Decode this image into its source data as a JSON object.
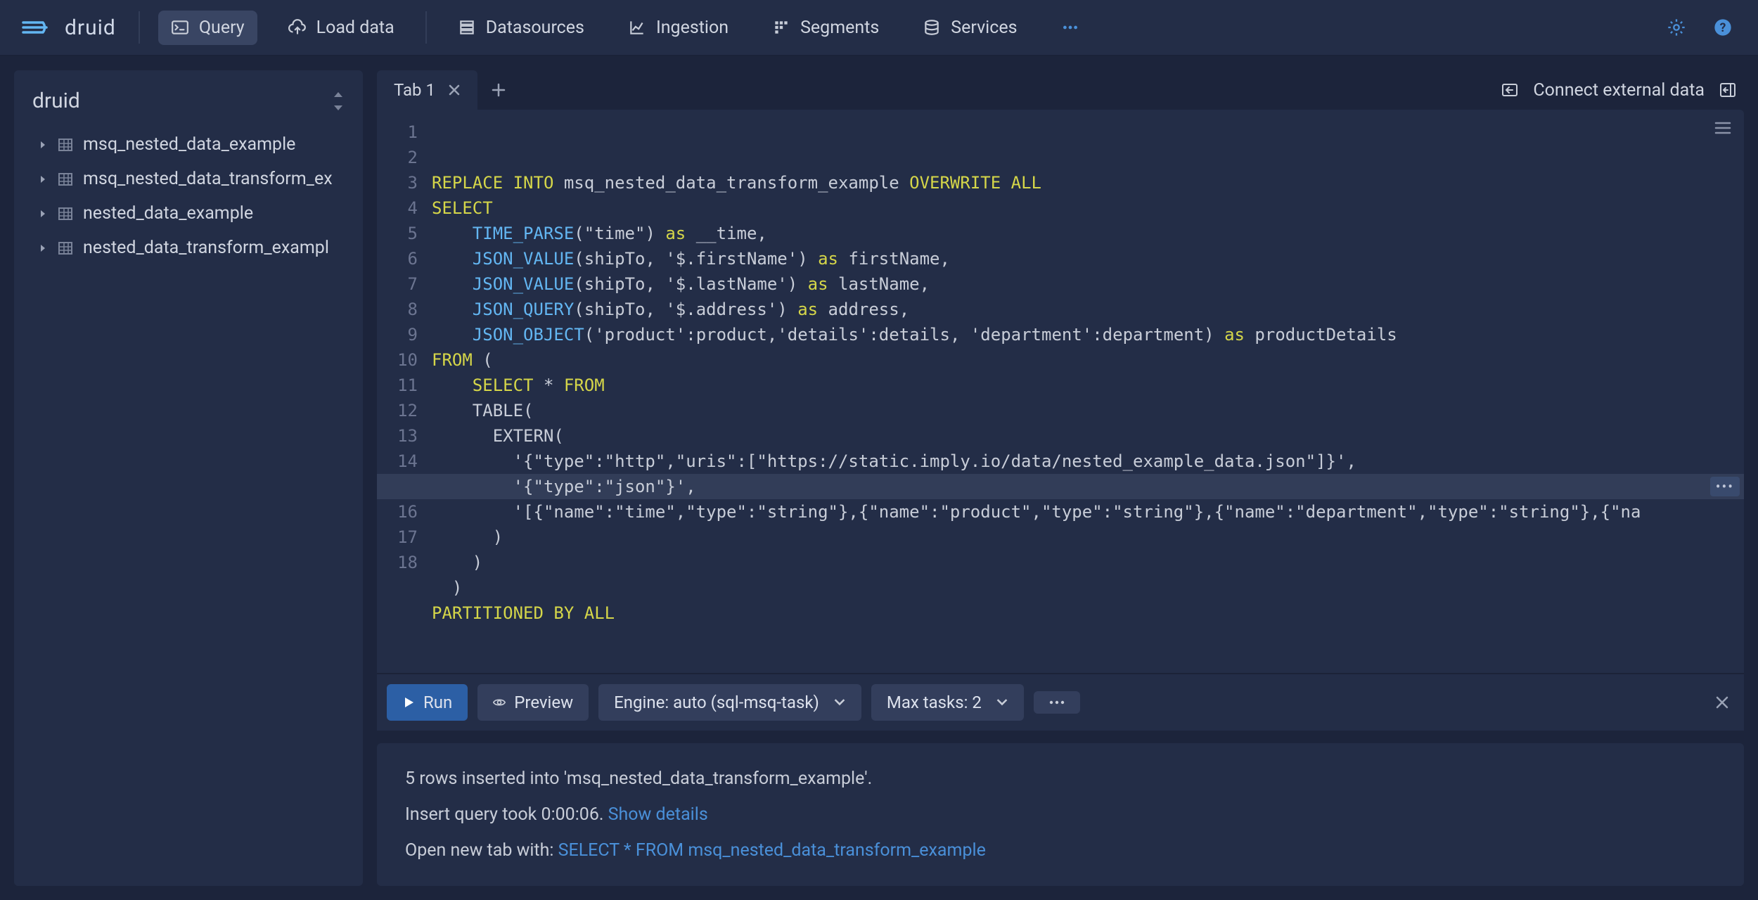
{
  "brand": "druid",
  "nav": {
    "query": "Query",
    "load_data": "Load data",
    "datasources": "Datasources",
    "ingestion": "Ingestion",
    "segments": "Segments",
    "services": "Services"
  },
  "sidebar": {
    "title": "druid",
    "items": [
      "msq_nested_data_example",
      "msq_nested_data_transform_ex",
      "nested_data_example",
      "nested_data_transform_exampl"
    ]
  },
  "tabs": {
    "tab1": "Tab 1"
  },
  "connect_external": "Connect external data",
  "editor": {
    "line_count": 18,
    "lines": [
      [
        [
          "kw",
          "REPLACE INTO"
        ],
        [
          "plain",
          " msq_nested_data_transform_example "
        ],
        [
          "kw",
          "OVERWRITE ALL"
        ]
      ],
      [
        [
          "kw",
          "SELECT"
        ]
      ],
      [
        [
          "plain",
          "    "
        ],
        [
          "fn",
          "TIME_PARSE"
        ],
        [
          "plain",
          "("
        ],
        [
          "str",
          "\"time\""
        ],
        [
          "plain",
          ") "
        ],
        [
          "kw",
          "as"
        ],
        [
          "plain",
          " __time,"
        ]
      ],
      [
        [
          "plain",
          "    "
        ],
        [
          "fn",
          "JSON_VALUE"
        ],
        [
          "plain",
          "(shipTo, "
        ],
        [
          "str",
          "'$.firstName'"
        ],
        [
          "plain",
          ") "
        ],
        [
          "kw",
          "as"
        ],
        [
          "plain",
          " firstName,"
        ]
      ],
      [
        [
          "plain",
          "    "
        ],
        [
          "fn",
          "JSON_VALUE"
        ],
        [
          "plain",
          "(shipTo, "
        ],
        [
          "str",
          "'$.lastName'"
        ],
        [
          "plain",
          ") "
        ],
        [
          "kw",
          "as"
        ],
        [
          "plain",
          " lastName,"
        ]
      ],
      [
        [
          "plain",
          "    "
        ],
        [
          "fn",
          "JSON_QUERY"
        ],
        [
          "plain",
          "(shipTo, "
        ],
        [
          "str",
          "'$.address'"
        ],
        [
          "plain",
          ") "
        ],
        [
          "kw",
          "as"
        ],
        [
          "plain",
          " address,"
        ]
      ],
      [
        [
          "plain",
          "    "
        ],
        [
          "fn",
          "JSON_OBJECT"
        ],
        [
          "plain",
          "("
        ],
        [
          "str",
          "'product'"
        ],
        [
          "plain",
          ":product,"
        ],
        [
          "str",
          "'details'"
        ],
        [
          "plain",
          ":details, "
        ],
        [
          "str",
          "'department'"
        ],
        [
          "plain",
          ":department) "
        ],
        [
          "kw",
          "as"
        ],
        [
          "plain",
          " productDetails"
        ]
      ],
      [
        [
          "kw",
          "FROM"
        ],
        [
          "plain",
          " ("
        ]
      ],
      [
        [
          "plain",
          "    "
        ],
        [
          "kw",
          "SELECT"
        ],
        [
          "plain",
          " * "
        ],
        [
          "kw",
          "FROM"
        ]
      ],
      [
        [
          "plain",
          "    TABLE("
        ]
      ],
      [
        [
          "plain",
          "      EXTERN("
        ]
      ],
      [
        [
          "plain",
          "        "
        ],
        [
          "str",
          "'{\"type\":\"http\",\"uris\":[\"https://static.imply.io/data/nested_example_data.json\"]}'"
        ],
        [
          "plain",
          ","
        ]
      ],
      [
        [
          "plain",
          "        "
        ],
        [
          "str",
          "'{\"type\":\"json\"}'"
        ],
        [
          "plain",
          ","
        ]
      ],
      [
        [
          "plain",
          "        "
        ],
        [
          "str",
          "'[{\"name\":\"time\",\"type\":\"string\"},{\"name\":\"product\",\"type\":\"string\"},{\"name\":\"department\",\"type\":\"string\"},{\"na"
        ]
      ],
      [
        [
          "plain",
          "      )"
        ]
      ],
      [
        [
          "plain",
          "    )"
        ]
      ],
      [
        [
          "plain",
          "  )"
        ]
      ],
      [
        [
          "kw",
          "PARTITIONED BY ALL"
        ]
      ]
    ]
  },
  "toolbar": {
    "run": "Run",
    "preview": "Preview",
    "engine": "Engine: auto (sql-msq-task)",
    "max_tasks": "Max tasks: 2"
  },
  "results": {
    "line1": "5 rows inserted into 'msq_nested_data_transform_example'.",
    "line2_prefix": "Insert query took 0:00:06. ",
    "line2_link": "Show details",
    "line3_prefix": "Open new tab with: ",
    "line3_link": "SELECT * FROM msq_nested_data_transform_example"
  }
}
